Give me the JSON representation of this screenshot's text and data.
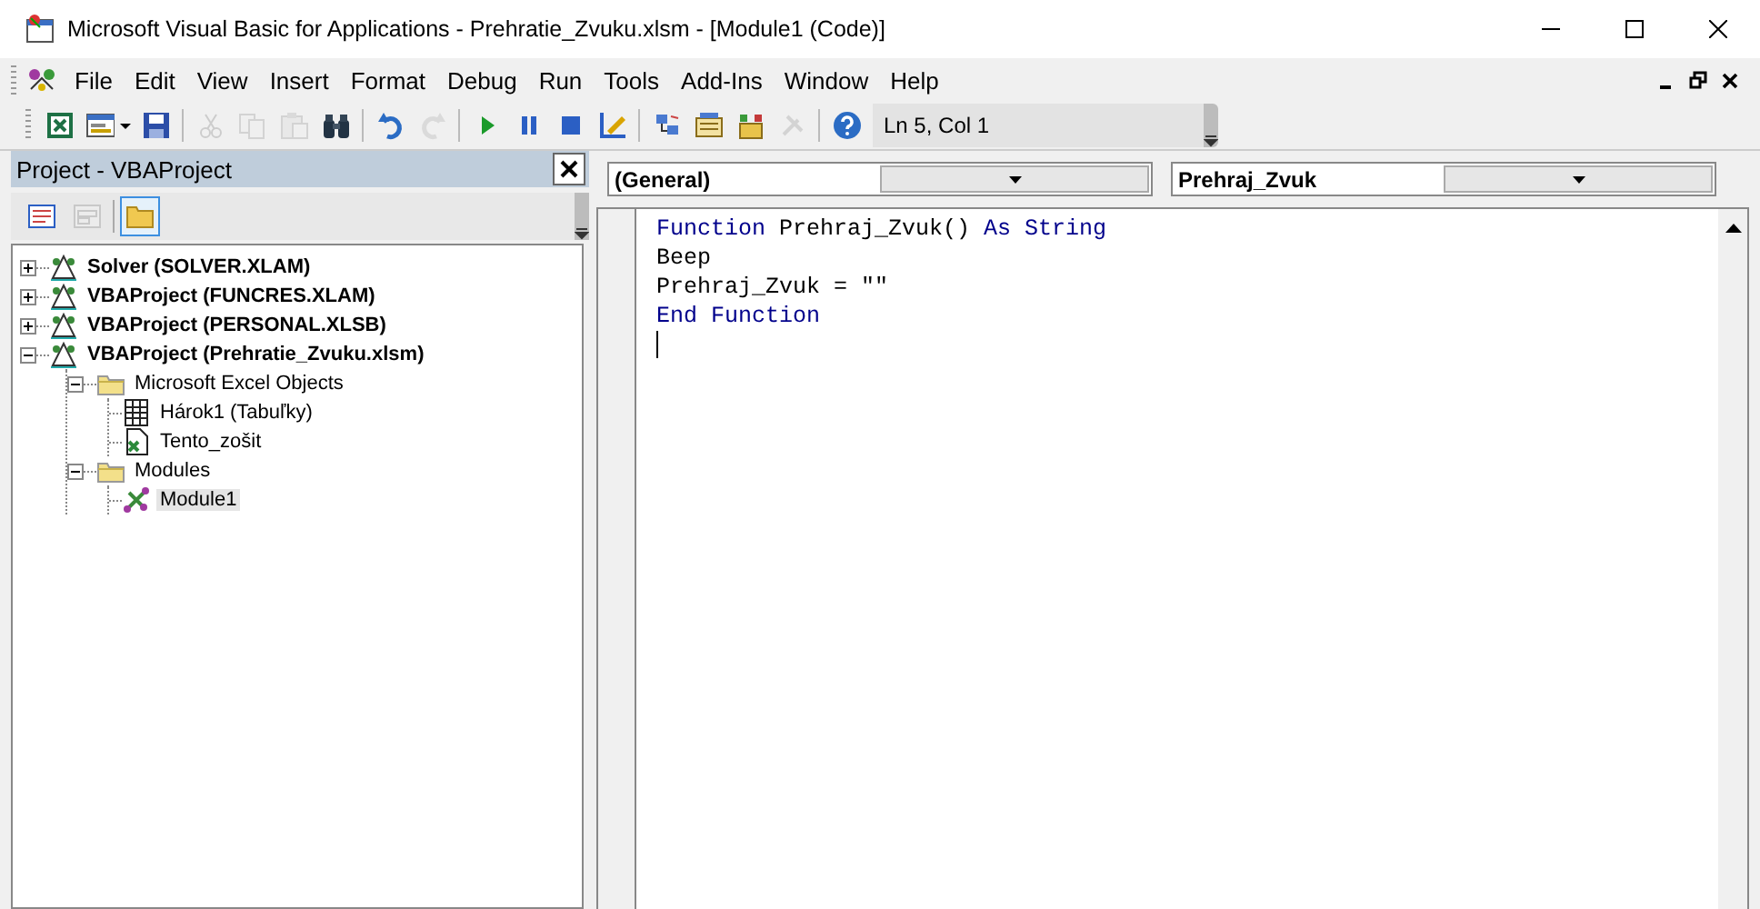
{
  "window": {
    "title": "Microsoft Visual Basic for Applications - Prehratie_Zvuku.xlsm - [Module1 (Code)]"
  },
  "menu": [
    {
      "label": "File"
    },
    {
      "label": "Edit"
    },
    {
      "label": "View"
    },
    {
      "label": "Insert"
    },
    {
      "label": "Format"
    },
    {
      "label": "Debug"
    },
    {
      "label": "Run"
    },
    {
      "label": "Tools"
    },
    {
      "label": "Add-Ins"
    },
    {
      "label": "Window"
    },
    {
      "label": "Help"
    }
  ],
  "toolbar": {
    "buttons": [
      {
        "kind": "excel",
        "disabled": false
      },
      {
        "kind": "userform",
        "disabled": false
      },
      {
        "kind": "save",
        "disabled": false
      },
      {
        "kind": "sep"
      },
      {
        "kind": "cut",
        "disabled": true
      },
      {
        "kind": "copy",
        "disabled": true
      },
      {
        "kind": "paste",
        "disabled": true
      },
      {
        "kind": "find",
        "disabled": false
      },
      {
        "kind": "sep"
      },
      {
        "kind": "undo",
        "disabled": false
      },
      {
        "kind": "redo",
        "disabled": true
      },
      {
        "kind": "sep"
      },
      {
        "kind": "run",
        "disabled": false
      },
      {
        "kind": "pause",
        "disabled": false
      },
      {
        "kind": "stop",
        "disabled": false
      },
      {
        "kind": "design",
        "disabled": false
      },
      {
        "kind": "sep"
      },
      {
        "kind": "explorer",
        "disabled": false
      },
      {
        "kind": "properties",
        "disabled": false
      },
      {
        "kind": "browser",
        "disabled": false
      },
      {
        "kind": "toolbox",
        "disabled": true
      },
      {
        "kind": "sep"
      },
      {
        "kind": "help",
        "disabled": false
      }
    ],
    "position": "Ln 5, Col 1"
  },
  "project": {
    "title": "Project - VBAProject",
    "view_buttons": [
      {
        "kind": "view-code",
        "selected": false,
        "disabled": false
      },
      {
        "kind": "view-object",
        "selected": false,
        "disabled": true
      },
      {
        "kind": "toggle-folders",
        "selected": true,
        "disabled": false
      }
    ],
    "tree": [
      {
        "label": "Solver (SOLVER.XLAM)",
        "kind": "project",
        "expanded": false,
        "selected": false
      },
      {
        "label": "VBAProject (FUNCRES.XLAM)",
        "kind": "project",
        "expanded": false,
        "selected": false
      },
      {
        "label": "VBAProject (PERSONAL.XLSB)",
        "kind": "project",
        "expanded": false,
        "selected": false
      },
      {
        "label": "VBAProject (Prehratie_Zvuku.xlsm)",
        "kind": "project",
        "expanded": true,
        "selected": false,
        "children": [
          {
            "label": "Microsoft Excel Objects",
            "kind": "folder",
            "expanded": true,
            "selected": false,
            "children": [
              {
                "label": "Hárok1 (Tabuľky)",
                "kind": "sheet",
                "selected": false
              },
              {
                "label": "Tento_zošit",
                "kind": "workbook",
                "selected": false
              }
            ]
          },
          {
            "label": "Modules",
            "kind": "folder",
            "expanded": true,
            "selected": false,
            "children": [
              {
                "label": "Module1",
                "kind": "module",
                "selected": true
              }
            ]
          }
        ]
      }
    ]
  },
  "code": {
    "object": "(General)",
    "procedure": "Prehraj_Zvuk",
    "lines": [
      [
        {
          "text": "Function",
          "kind": "keyword"
        },
        {
          "text": " Prehraj_Zvuk() ",
          "kind": "plain"
        },
        {
          "text": "As String",
          "kind": "keyword"
        }
      ],
      [
        {
          "text": "Beep",
          "kind": "plain"
        }
      ],
      [
        {
          "text": "Prehraj_Zvuk = \"\"",
          "kind": "plain"
        }
      ],
      [
        {
          "text": "End Function",
          "kind": "keyword"
        }
      ]
    ]
  }
}
